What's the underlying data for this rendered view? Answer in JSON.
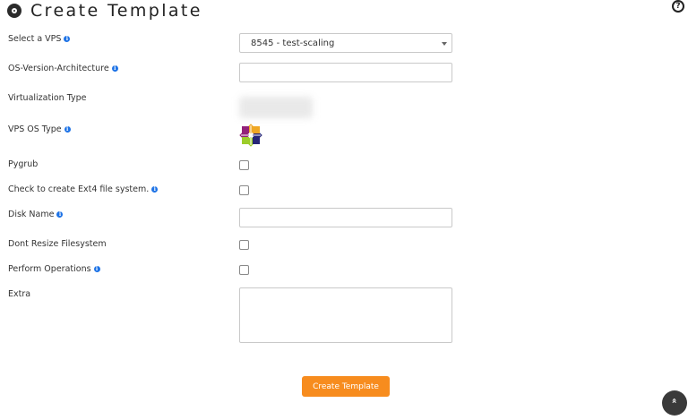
{
  "header": {
    "title": "Create Template"
  },
  "help": {
    "glyph": "?"
  },
  "fields": {
    "select_vps": {
      "label": "Select a VPS",
      "value": "8545 - test-scaling"
    },
    "os_version": {
      "label": "OS-Version-Architecture",
      "value": ""
    },
    "virtualization": {
      "label": "Virtualization Type",
      "value": ""
    },
    "vps_os_type": {
      "label": "VPS OS Type",
      "icon": "centos-logo-icon"
    },
    "pygrub": {
      "label": "Pygrub",
      "checked": false
    },
    "ext4": {
      "label": "Check to create Ext4 file system.",
      "checked": false
    },
    "disk_name": {
      "label": "Disk Name",
      "value": ""
    },
    "dont_resize": {
      "label": "Dont Resize Filesystem",
      "checked": false
    },
    "perform_ops": {
      "label": "Perform Operations",
      "checked": false
    },
    "extra": {
      "label": "Extra",
      "value": ""
    }
  },
  "actions": {
    "submit_label": "Create Template"
  },
  "scroll": {
    "glyph": "»"
  },
  "info_glyph": "i",
  "colors": {
    "accent": "#f78c1e",
    "info": "#1e73e6"
  }
}
